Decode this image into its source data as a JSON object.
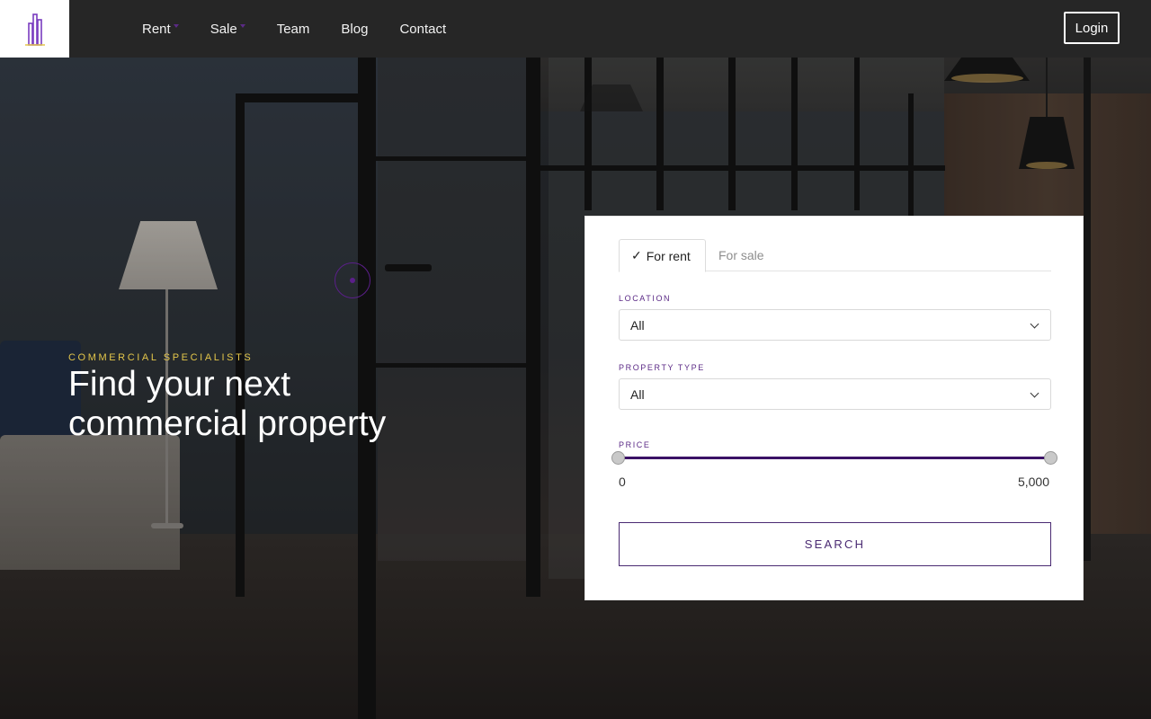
{
  "nav": {
    "logo_icon": "building-logo-icon",
    "items": [
      {
        "label": "Rent",
        "has_dropdown": true
      },
      {
        "label": "Sale",
        "has_dropdown": true
      },
      {
        "label": "Team",
        "has_dropdown": false
      },
      {
        "label": "Blog",
        "has_dropdown": false
      },
      {
        "label": "Contact",
        "has_dropdown": false
      }
    ],
    "login_label": "Login"
  },
  "hero": {
    "eyebrow": "COMMERCIAL SPECIALISTS",
    "headline_line1": "Find your next",
    "headline_line2": "commercial property"
  },
  "search": {
    "tabs": [
      {
        "label": "For rent",
        "selected": true
      },
      {
        "label": "For sale",
        "selected": false
      }
    ],
    "location": {
      "label": "LOCATION",
      "value": "All"
    },
    "property_type": {
      "label": "PROPERTY TYPE",
      "value": "All"
    },
    "price": {
      "label": "PRICE",
      "min": "0",
      "max": "5,000"
    },
    "button_label": "SEARCH"
  },
  "colors": {
    "nav_bg": "#262626",
    "accent_purple": "#5b2a86",
    "eyebrow_gold": "#e3c64a"
  }
}
